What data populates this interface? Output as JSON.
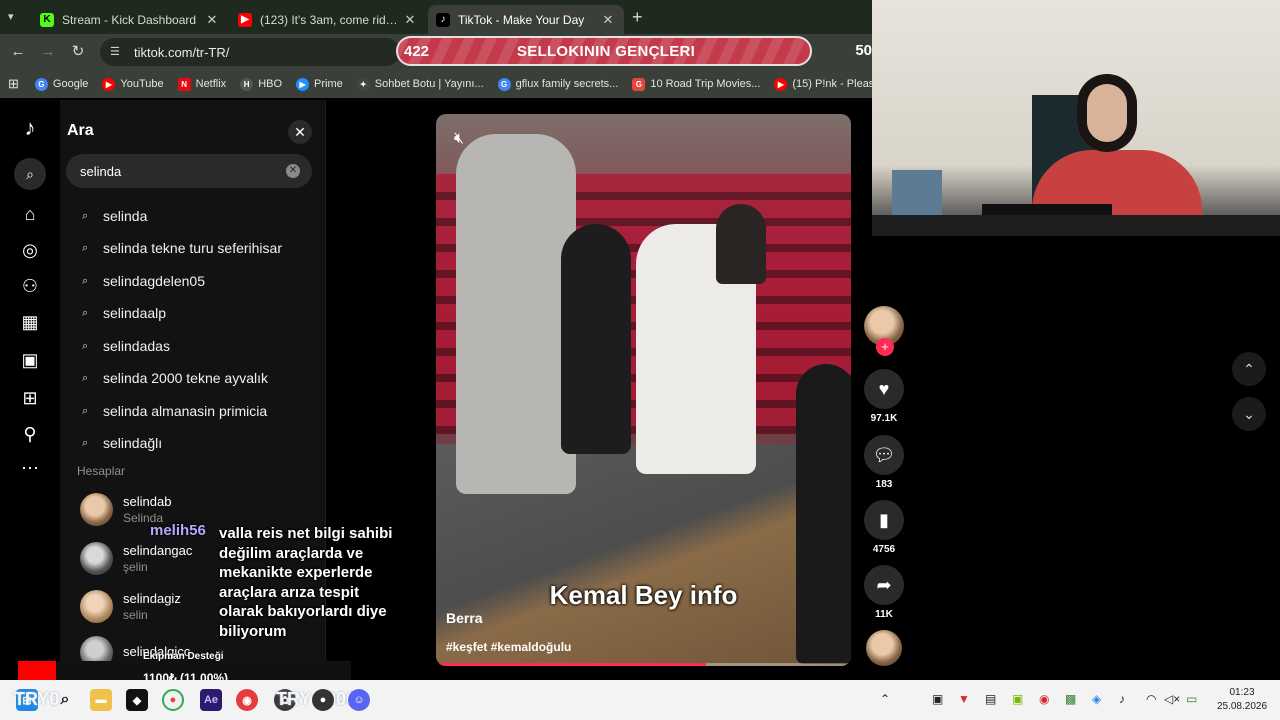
{
  "browser": {
    "tabs": [
      {
        "title": "Stream - Kick Dashboard",
        "favicon": "kick-icon",
        "active": false
      },
      {
        "title": "(123) It's 3am, come ride with me",
        "favicon": "youtube-icon",
        "active": false
      },
      {
        "title": "TikTok - Make Your Day",
        "favicon": "tiktok-icon",
        "active": true
      }
    ],
    "new_tab": "+",
    "url": "tiktok.com/tr-TR/",
    "bookmarks": [
      {
        "label": "Google",
        "color": "#4285f4",
        "glyph": "G"
      },
      {
        "label": "YouTube",
        "color": "#ff0000",
        "glyph": "▶"
      },
      {
        "label": "Netflix",
        "color": "#e50914",
        "glyph": "N"
      },
      {
        "label": "HBO",
        "color": "#555555",
        "glyph": "H"
      },
      {
        "label": "Prime",
        "color": "#1e90ff",
        "glyph": "▶"
      },
      {
        "label": "Sohbet Botu | Yayını...",
        "color": "#444444",
        "glyph": "✦"
      },
      {
        "label": "gflux family secrets...",
        "color": "#4285f4",
        "glyph": "G"
      },
      {
        "label": "10 Road Trip Movies...",
        "color": "#e8453c",
        "glyph": "G"
      },
      {
        "label": "(15) P!nk - Please D...",
        "color": "#ff0000",
        "glyph": "▶"
      }
    ]
  },
  "overlay_banner": {
    "count_left": "422",
    "title": "SELLOKININ GENÇLERI",
    "count_right": "50"
  },
  "tiktok": {
    "search_panel": {
      "title": "Ara",
      "query": "selinda",
      "suggestions": [
        "selinda",
        "selinda tekne turu seferihisar",
        "selindagdelen05",
        "selindaalp",
        "selindadas",
        "selinda 2000 tekne ayvalık",
        "selinda almanasin primicia",
        "selindağlı"
      ],
      "accounts_heading": "Hesaplar",
      "accounts": [
        {
          "name": "selindab",
          "sub": "Selinda"
        },
        {
          "name": "selindangac",
          "sub": "şelin"
        },
        {
          "name": "selindagiz",
          "sub": "selin"
        },
        {
          "name": "selindalgicc",
          "sub": ""
        }
      ]
    },
    "video": {
      "caption_overlay": "Kemal Bey info",
      "author": "Berra",
      "hashtags": "#keşfet #kemaldoğulu",
      "progress": 0.65
    },
    "actions": {
      "likes": "97.1K",
      "comments": "183",
      "saves": "4756",
      "shares": "11K"
    }
  },
  "chat": {
    "user": "melih56",
    "message": "valla reis net bilgi sahibi değilim araçlarda ve mekanikte experlerde araçlara arıza tespit olarak bakıyorlardı diye biliyorum"
  },
  "donation": {
    "label": "Ekipman Desteği",
    "value": "1100₺ (11.00%)",
    "progress": 0.11
  },
  "taskbar": {
    "clock_time": "01:23",
    "clock_date": "25.08.2026",
    "ghost_left": "TRY0",
    "ghost_mid": "TRY 10000"
  }
}
